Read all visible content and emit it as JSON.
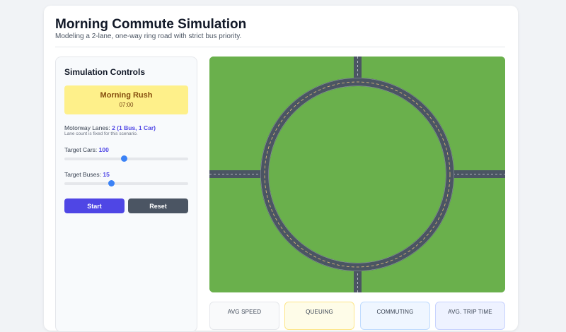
{
  "header": {
    "title": "Morning Commute Simulation",
    "subtitle": "Modeling a 2-lane, one-way ring road with strict bus priority."
  },
  "controls": {
    "title": "Simulation Controls",
    "scenario": {
      "name": "Morning Rush",
      "time": "07:00",
      "color": "#fef08a"
    },
    "lanes": {
      "label": "Motorway Lanes:",
      "value": "2 (1 Bus, 1 Car)",
      "note": "Lane count is fixed for this scenario."
    },
    "cars": {
      "label": "Target Cars:",
      "value": "100",
      "level": 0.48
    },
    "buses": {
      "label": "Target Buses:",
      "value": "15",
      "level": 0.38
    },
    "start_label": "Start",
    "reset_label": "Reset"
  },
  "map": {
    "grass_color": "#6ab04c",
    "road_color": "#4b5563",
    "lane_marking_color": "#e8c27a"
  },
  "stats": [
    {
      "label": "AVG SPEED"
    },
    {
      "label": "QUEUING"
    },
    {
      "label": "COMMUTING"
    },
    {
      "label": "AVG. TRIP TIME"
    }
  ]
}
